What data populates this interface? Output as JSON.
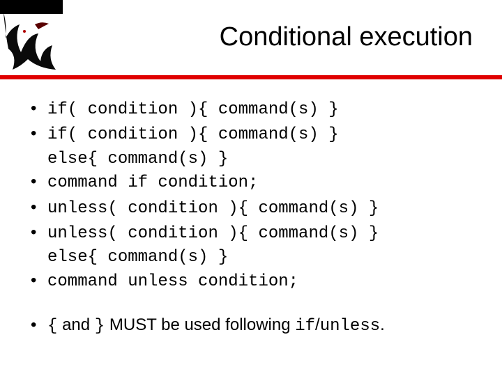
{
  "header": {
    "title": "Conditional execution",
    "logo_alt": "dragon-logo"
  },
  "bullets": [
    {
      "line": "if( condition ){ command(s) }",
      "mono": true
    },
    {
      "line": "if( condition ){ command(s) }",
      "cont": "else{ command(s) }",
      "mono": true
    },
    {
      "line": "command if condition;",
      "mono": true
    },
    {
      "line": "unless( condition ){ command(s) }",
      "mono": true
    },
    {
      "line": "unless( condition ){ command(s) }",
      "cont": "else{ command(s) }",
      "mono": true
    },
    {
      "line": "command unless condition;",
      "mono": true
    }
  ],
  "footnote": {
    "braces_open": "{",
    "and_text": " and ",
    "braces_close": "}",
    "middle_text": " MUST be used following ",
    "if_text": "if",
    "slash": "/",
    "unless_text": "unless",
    "period": "."
  }
}
